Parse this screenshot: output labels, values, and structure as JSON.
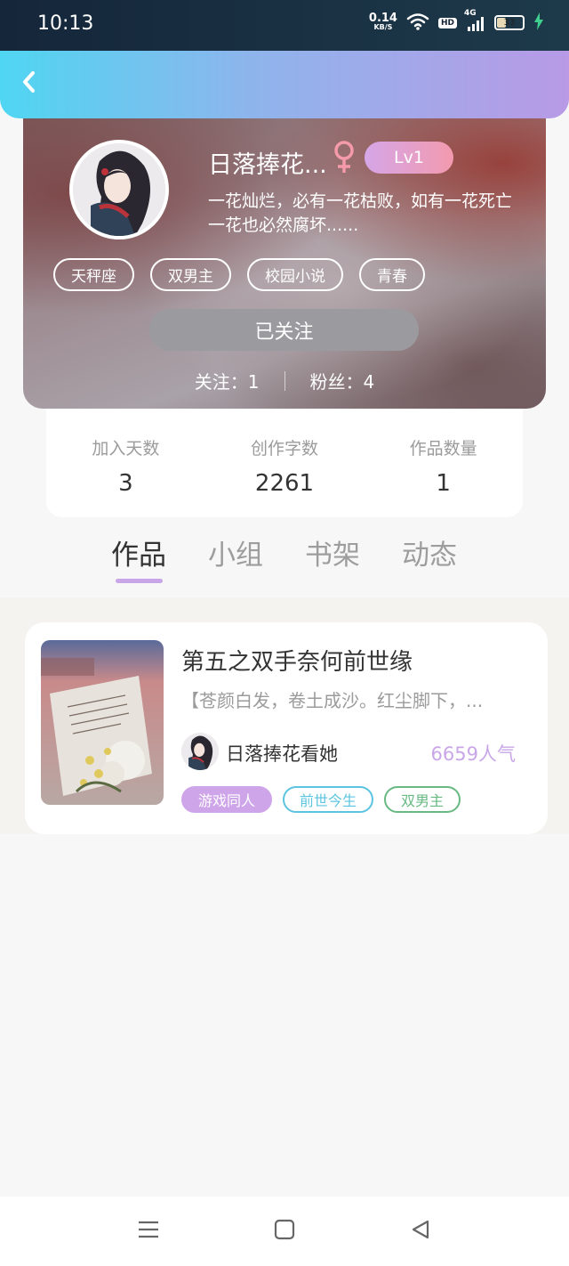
{
  "status_bar": {
    "time": "10:13",
    "net_speed_value": "0.14",
    "net_speed_unit": "KB/S",
    "hd_label": "HD",
    "network_label": "4G",
    "battery_level": "33",
    "icons": [
      "wifi-icon",
      "signal-icon",
      "battery-icon",
      "charging-icon"
    ]
  },
  "header": {
    "back_icon": "chevron-left-icon"
  },
  "profile": {
    "username": "日落捧花...",
    "gender_symbol": "♀",
    "level": "Lv1",
    "bio": "一花灿烂，必有一花枯败，如有一花死亡\n一花也必然腐坏......",
    "tags": [
      "天秤座",
      "双男主",
      "校园小说",
      "青春"
    ],
    "follow_button_label": "已关注",
    "following_label": "关注：1",
    "fans_label": "粉丝：4",
    "accent_colors": {
      "level_start": "#d5a6e8",
      "level_end": "#f39aae",
      "gender": "#f49aa8"
    }
  },
  "stats": [
    {
      "label": "加入天数",
      "value": "3"
    },
    {
      "label": "创作字数",
      "value": "2261"
    },
    {
      "label": "作品数量",
      "value": "1"
    }
  ],
  "tabs": [
    {
      "label": "作品",
      "active": true
    },
    {
      "label": "小组",
      "active": false
    },
    {
      "label": "书架",
      "active": false
    },
    {
      "label": "动态",
      "active": false
    }
  ],
  "works": [
    {
      "title": "第五之双手奈何前世缘",
      "description": "【苍颜白发，卷土成沙。红尘脚下，...",
      "author": "日落捧花看她",
      "popularity": "6659人气",
      "tags": [
        "游戏同人",
        "前世今生",
        "双男主"
      ]
    }
  ],
  "nav_bar": {
    "icons": [
      "menu-icon",
      "home-square-icon",
      "back-triangle-icon"
    ]
  }
}
